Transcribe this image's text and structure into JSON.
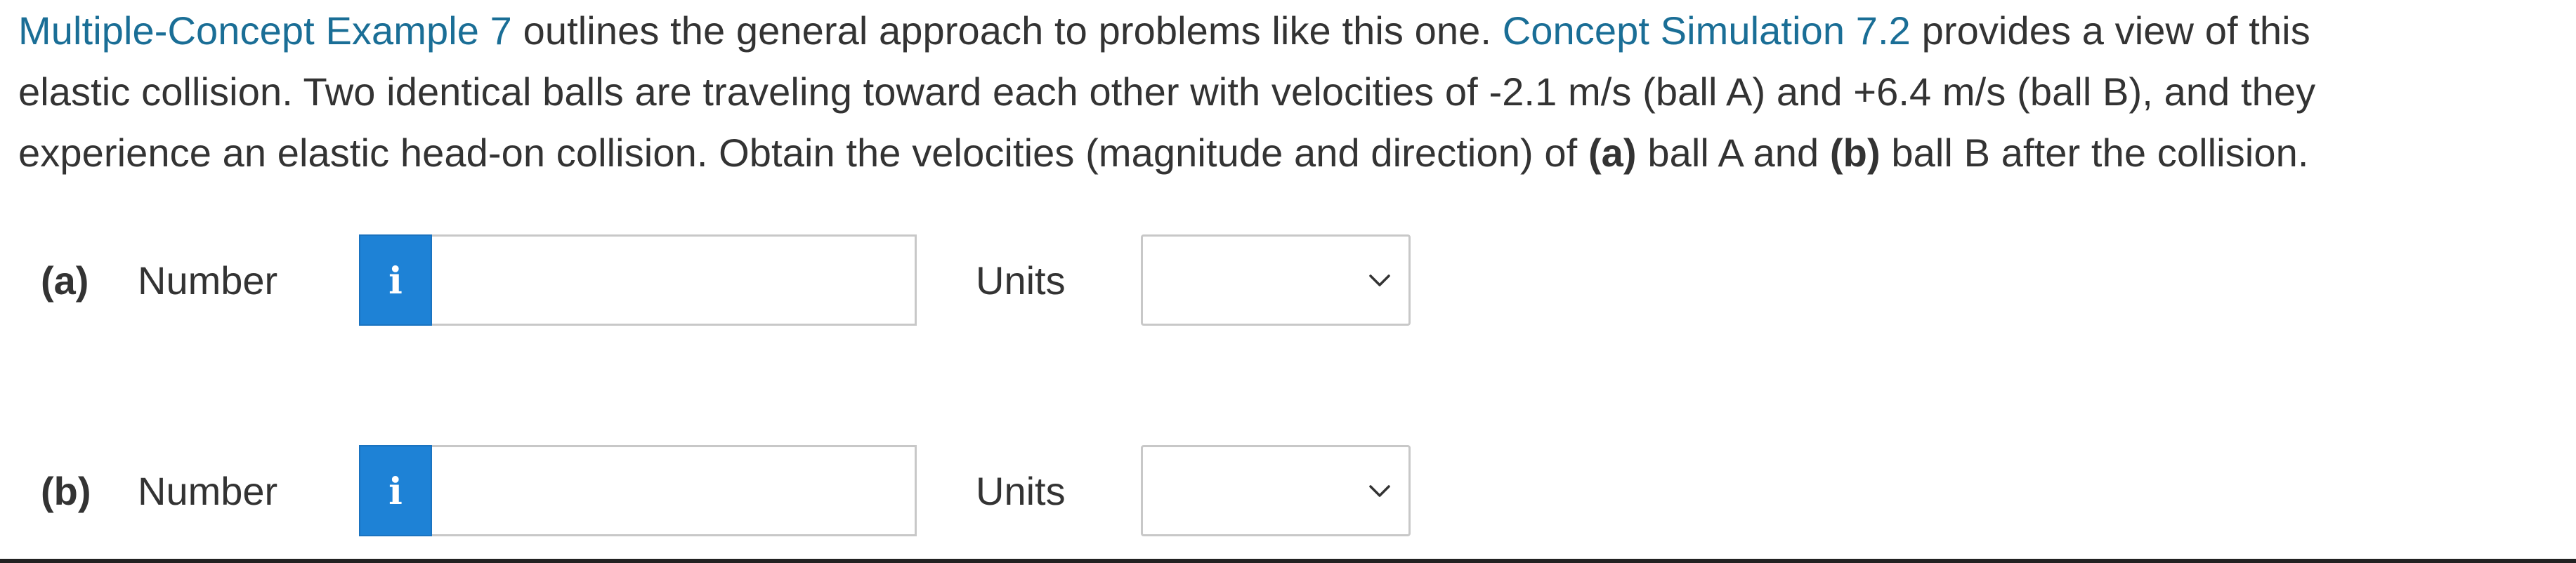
{
  "problem": {
    "line1": {
      "link1": "Multiple-Concept Example 7",
      "text1": " outlines the general approach to problems like this one. ",
      "link2": "Concept Simulation 7.2",
      "text2": " provides a view of this"
    },
    "line2": "elastic collision. Two identical balls are traveling toward each other with velocities of -2.1 m/s (ball A) and +6.4 m/s (ball B), and they",
    "line3": {
      "text1": "experience an elastic head-on collision. Obtain the velocities (magnitude and direction) of ",
      "bold_a": "(a)",
      "text2": " ball A and ",
      "bold_b": "(b)",
      "text3": " ball B after the collision."
    }
  },
  "answers": [
    {
      "part_label": "(a)",
      "number_label": "Number",
      "info_glyph": "i",
      "number_value": "",
      "units_label": "Units",
      "units_selected": ""
    },
    {
      "part_label": "(b)",
      "number_label": "Number",
      "info_glyph": "i",
      "number_value": "",
      "units_label": "Units",
      "units_selected": ""
    }
  ],
  "colors": {
    "link": "#1a6e96",
    "info_button": "#1e82d6",
    "text": "#333333",
    "border": "#c8c8c8"
  },
  "icons": {
    "info": "info-icon",
    "dropdown": "chevron-down-icon"
  }
}
